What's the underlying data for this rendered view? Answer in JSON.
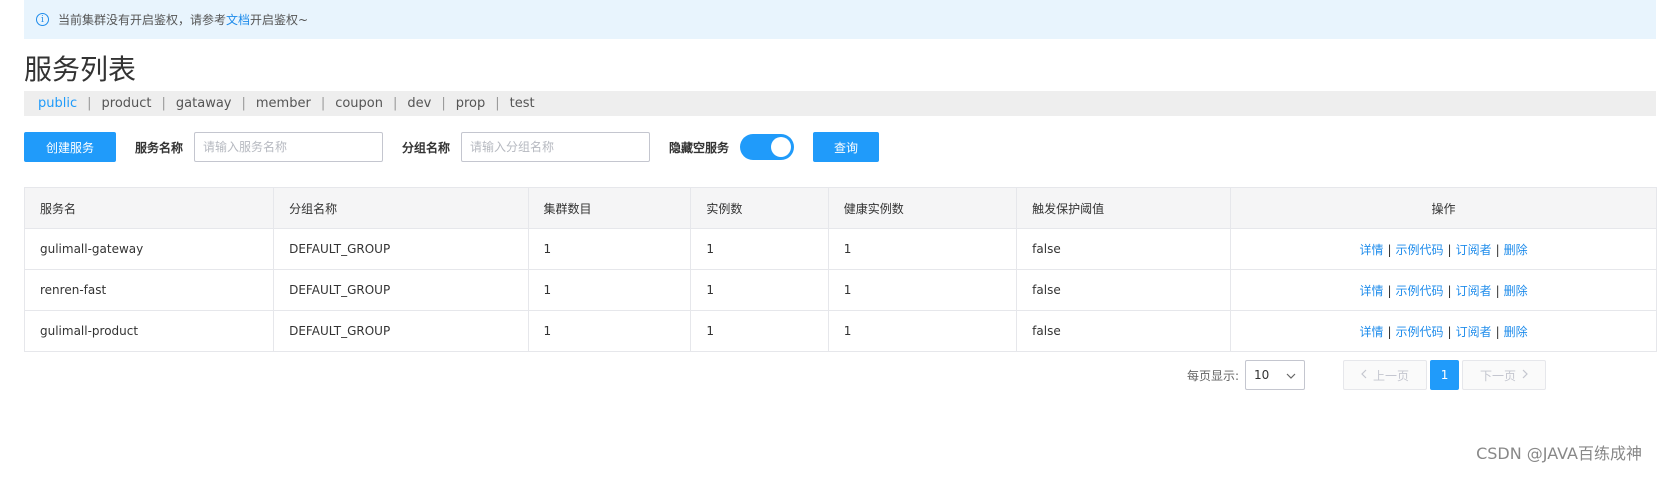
{
  "notice": {
    "text_before": "当前集群没有开启鉴权，请参考",
    "link": "文档",
    "text_after": "开启鉴权~"
  },
  "title": "服务列表",
  "namespaces": [
    "public",
    "product",
    "gataway",
    "member",
    "coupon",
    "dev",
    "prop",
    "test"
  ],
  "active_namespace": "public",
  "toolbar": {
    "create_label": "创建服务",
    "service_name_label": "服务名称",
    "service_name_placeholder": "请输入服务名称",
    "group_name_label": "分组名称",
    "group_name_placeholder": "请输入分组名称",
    "hide_empty_label": "隐藏空服务",
    "hide_empty_on": true,
    "query_label": "查询"
  },
  "table": {
    "headers": [
      "服务名",
      "分组名称",
      "集群数目",
      "实例数",
      "健康实例数",
      "触发保护阈值",
      "操作"
    ],
    "rows": [
      [
        "gulimall-gateway",
        "DEFAULT_GROUP",
        "1",
        "1",
        "1",
        "false"
      ],
      [
        "renren-fast",
        "DEFAULT_GROUP",
        "1",
        "1",
        "1",
        "false"
      ],
      [
        "gulimall-product",
        "DEFAULT_GROUP",
        "1",
        "1",
        "1",
        "false"
      ]
    ],
    "actions": [
      "详情",
      "示例代码",
      "订阅者",
      "删除"
    ]
  },
  "pagination": {
    "per_page_label": "每页显示:",
    "per_page_value": "10",
    "prev_label": "上一页",
    "current_page": "1",
    "next_label": "下一页"
  },
  "watermark": "CSDN @JAVA百练成神",
  "colors": {
    "primary": "#209bfa",
    "link": "#1f8ceb",
    "notice_bg": "#e8f4fd"
  }
}
